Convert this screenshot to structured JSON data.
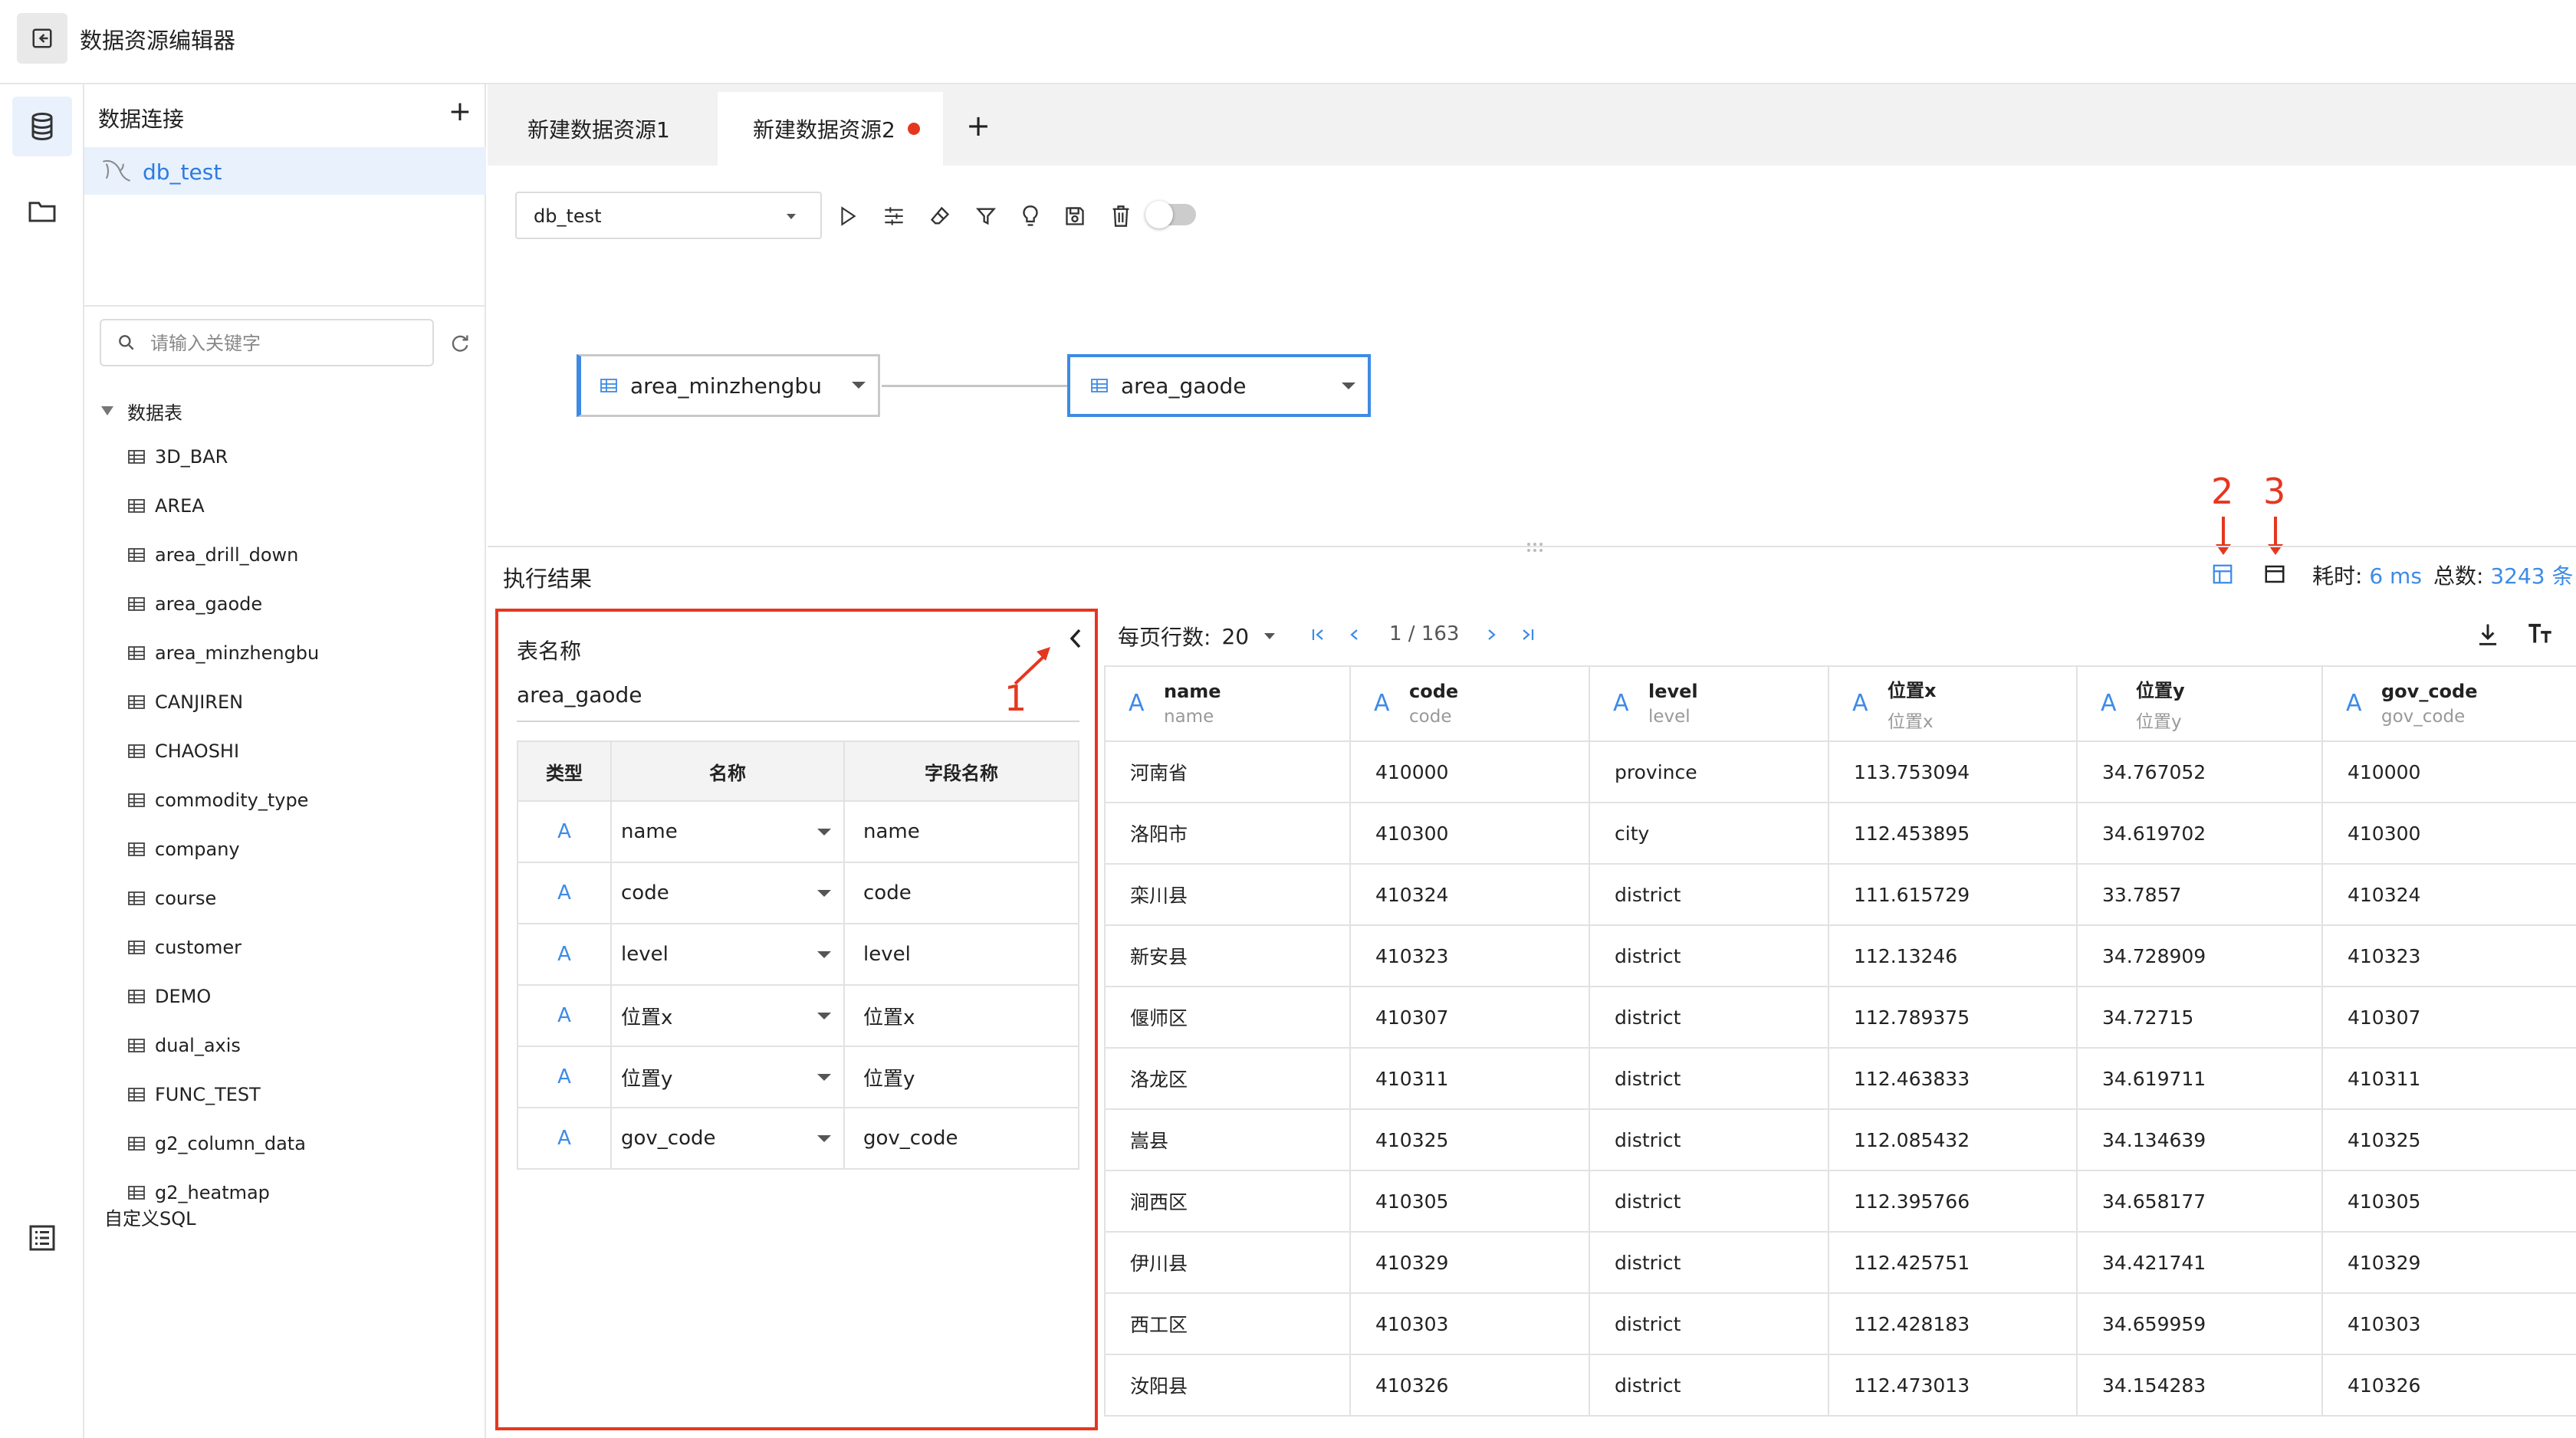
{
  "app": {
    "title": "数据资源编辑器"
  },
  "sidebar": {
    "connections_title": "数据连接",
    "connection": "db_test",
    "search_placeholder": "请输入关键字",
    "tables_group": "数据表",
    "tables": [
      "3D_BAR",
      "AREA",
      "area_drill_down",
      "area_gaode",
      "area_minzhengbu",
      "CANJIREN",
      "CHAOSHI",
      "commodity_type",
      "company",
      "course",
      "customer",
      "DEMO",
      "dual_axis",
      "FUNC_TEST",
      "g2_column_data",
      "g2_heatmap"
    ],
    "custom_sql": "自定义SQL"
  },
  "tabs": [
    {
      "label": "新建数据资源1"
    },
    {
      "label": "新建数据资源2",
      "unsaved": true
    }
  ],
  "toolbar": {
    "database": "db_test"
  },
  "canvas": {
    "nodes": [
      {
        "label": "area_minzhengbu"
      },
      {
        "label": "area_gaode"
      }
    ]
  },
  "annotations": [
    "1",
    "2",
    "3"
  ],
  "results": {
    "title": "执行结果",
    "time_label": "耗时:",
    "time_value": "6 ms",
    "total_label": "总数:",
    "total_value": "3243 条"
  },
  "field_panel": {
    "table_name_label": "表名称",
    "table_name": "area_gaode",
    "headers": [
      "类型",
      "名称",
      "字段名称"
    ],
    "rows": [
      {
        "type": "A",
        "name": "name",
        "field": "name"
      },
      {
        "type": "A",
        "name": "code",
        "field": "code"
      },
      {
        "type": "A",
        "name": "level",
        "field": "level"
      },
      {
        "type": "A",
        "name": "位置x",
        "field": "位置x"
      },
      {
        "type": "A",
        "name": "位置y",
        "field": "位置y"
      },
      {
        "type": "A",
        "name": "gov_code",
        "field": "gov_code"
      }
    ]
  },
  "grid": {
    "rows_per_page_label": "每页行数:",
    "rows_per_page": "20",
    "page_info": "1 / 163",
    "columns": [
      {
        "title": "name",
        "sub": "name"
      },
      {
        "title": "code",
        "sub": "code"
      },
      {
        "title": "level",
        "sub": "level"
      },
      {
        "title": "位置x",
        "sub": "位置x"
      },
      {
        "title": "位置y",
        "sub": "位置y"
      },
      {
        "title": "gov_code",
        "sub": "gov_code"
      }
    ],
    "rows": [
      [
        "河南省",
        "410000",
        "province",
        "113.753094",
        "34.767052",
        "410000"
      ],
      [
        "洛阳市",
        "410300",
        "city",
        "112.453895",
        "34.619702",
        "410300"
      ],
      [
        "栾川县",
        "410324",
        "district",
        "111.615729",
        "33.7857",
        "410324"
      ],
      [
        "新安县",
        "410323",
        "district",
        "112.13246",
        "34.728909",
        "410323"
      ],
      [
        "偃师区",
        "410307",
        "district",
        "112.789375",
        "34.72715",
        "410307"
      ],
      [
        "洛龙区",
        "410311",
        "district",
        "112.463833",
        "34.619711",
        "410311"
      ],
      [
        "嵩县",
        "410325",
        "district",
        "112.085432",
        "34.134639",
        "410325"
      ],
      [
        "涧西区",
        "410305",
        "district",
        "112.395766",
        "34.658177",
        "410305"
      ],
      [
        "伊川县",
        "410329",
        "district",
        "112.425751",
        "34.421741",
        "410329"
      ],
      [
        "西工区",
        "410303",
        "district",
        "112.428183",
        "34.659959",
        "410303"
      ],
      [
        "汝阳县",
        "410326",
        "district",
        "112.473013",
        "34.154283",
        "410326"
      ]
    ]
  }
}
